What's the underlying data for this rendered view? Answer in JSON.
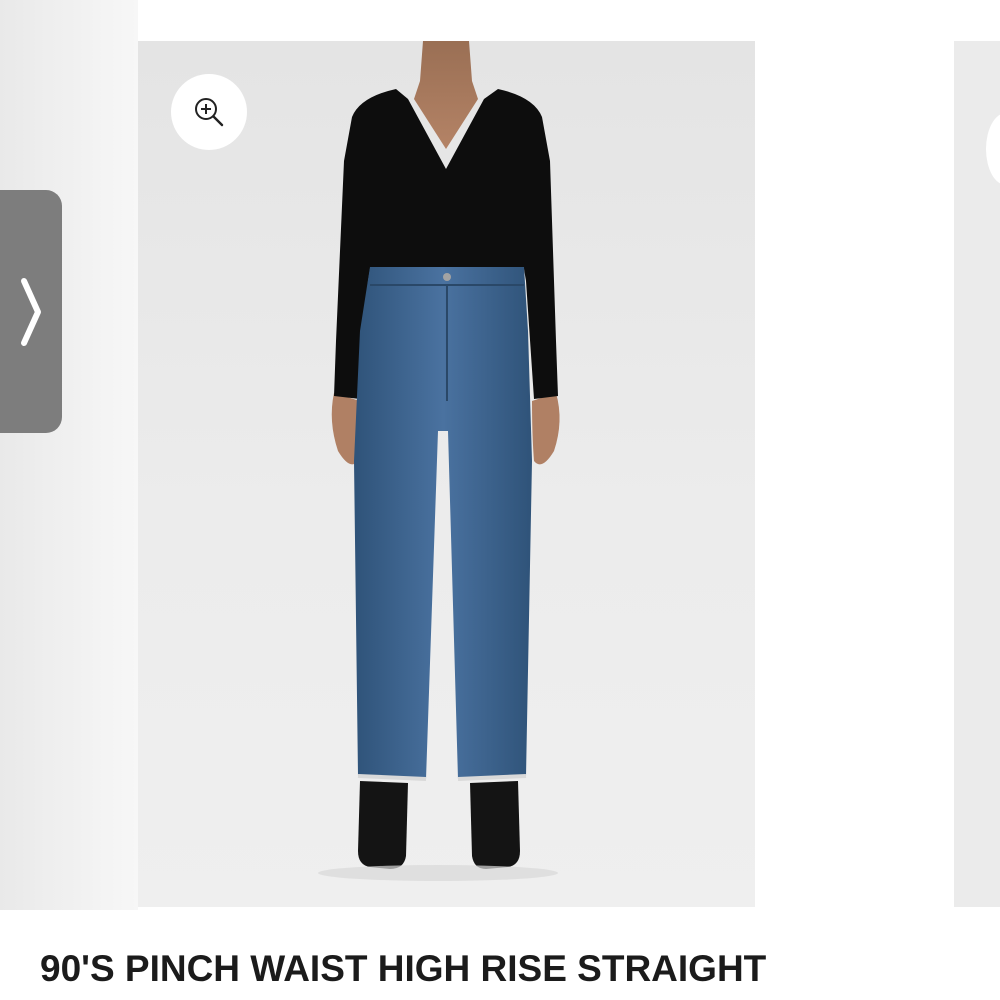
{
  "carousel": {
    "prev_icon": "chevron-right-icon",
    "zoom_icon": "zoom-in-icon",
    "main_image": "product-photo-model-black-top-blue-straight-jeans",
    "next_image": "product-photo-next-partial"
  },
  "product": {
    "title": "90'S PINCH WAIST HIGH RISE STRAIGHT"
  },
  "colors": {
    "arrow_bg": "#7d7d7d",
    "title_text": "#1b1b1b",
    "photo_bg": "#e8e8e8",
    "denim": "#3f6690",
    "top": "#0c0c0c"
  }
}
